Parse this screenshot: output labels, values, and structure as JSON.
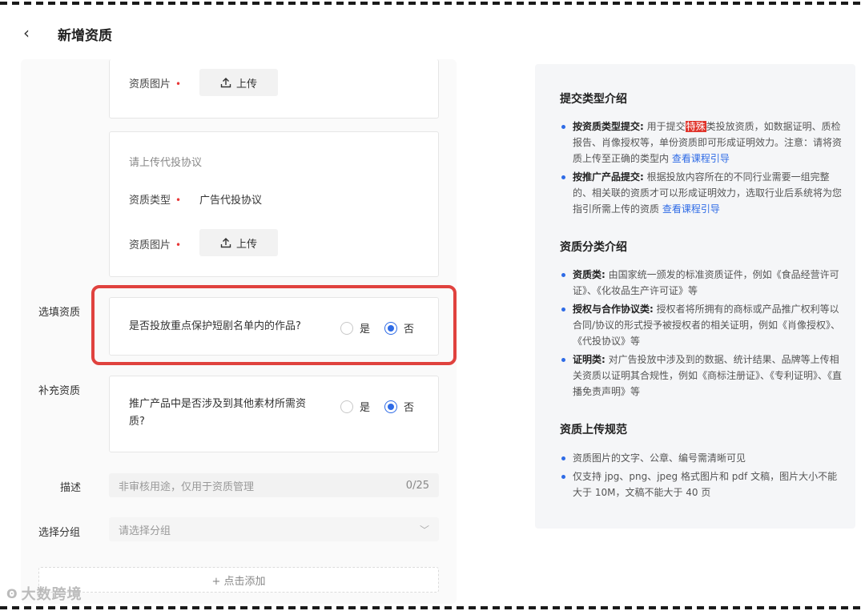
{
  "header": {
    "back_icon": "‹",
    "title": "新增资质"
  },
  "card1": {
    "image_label": "资质图片",
    "required": "•",
    "upload_label": "上传"
  },
  "card2": {
    "hint": "请上传代投协议",
    "type_label": "资质类型",
    "type_value": "广告代投协议",
    "image_label": "资质图片",
    "required": "•",
    "upload_label": "上传"
  },
  "optional_section": {
    "label": "选填资质",
    "question": "是否投放重点保护短剧名单内的作品?",
    "options": [
      {
        "label": "是",
        "selected": false
      },
      {
        "label": "否",
        "selected": true
      }
    ]
  },
  "supplement_section": {
    "label": "补充资质",
    "question_line1": "推广产品中是否涉及到其他素材所需资",
    "question_line2": "质?",
    "options": [
      {
        "label": "是",
        "selected": false
      },
      {
        "label": "否",
        "selected": true
      }
    ]
  },
  "description": {
    "label": "描述",
    "placeholder": "非审核用途，仅用于资质管理",
    "counter": "0/25"
  },
  "group": {
    "label": "选择分组",
    "placeholder": "请选择分组",
    "chevron": "﹀"
  },
  "add_button": "+ 点击添加",
  "right_panel": {
    "submit_title": "提交类型介绍",
    "submit_items": [
      {
        "bold": "按资质类型提交:",
        "text_a": "用于提交",
        "mark": "特殊",
        "text_b": "类投放资质，如数据证明、质检报告、肖像授权等，单份资质即可形成证明效力。注意：请将资质上传至正确的类型内",
        "link": "查看课程引导"
      },
      {
        "bold": "按推广产品提交:",
        "text": "根据投放内容所在的不同行业需要一组完整的、相关联的资质才可以形成证明效力，选取行业后系统将为您指引所需上传的资质",
        "link": "查看课程引导"
      }
    ],
    "category_title": "资质分类介绍",
    "category_items": [
      {
        "bold": "资质类:",
        "text": "由国家统一颁发的标准资质证件，例如《食品经营许可证》、《化妆品生产许可证》等"
      },
      {
        "bold": "授权与合作协议类:",
        "text": "授权者将所拥有的商标或产品推广权利等以合同/协议的形式授予被授权者的相关证明，例如《肖像授权》、《代投协议》等"
      },
      {
        "bold": "证明类:",
        "text": "对广告投放中涉及到的数据、统计结果、品牌等上传相关资质以证明其合规性，例如《商标注册证》、《专利证明》、《直播免责声明》等"
      }
    ],
    "upload_title": "资质上传规范",
    "upload_items": [
      "资质图片的文字、公章、编号需清晰可见",
      "仅支持 jpg、png、jpeg 格式图片和 pdf 文稿，图片大小不能大于 10M，文稿不能大于 40 页"
    ]
  },
  "watermark": {
    "mark": "ʘ",
    "text": "大数跨境"
  }
}
